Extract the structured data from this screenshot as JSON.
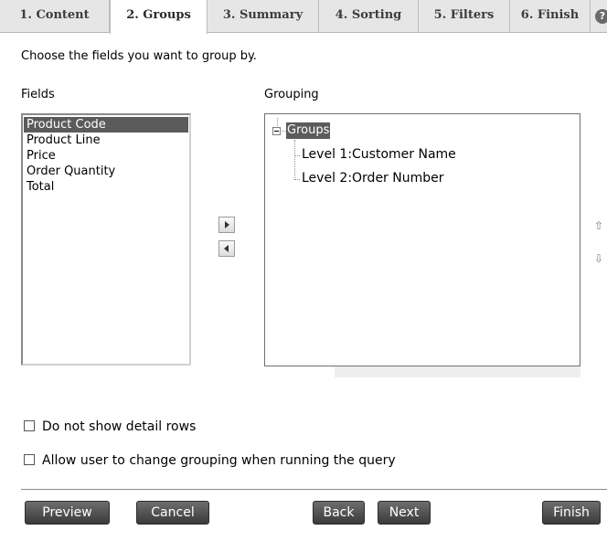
{
  "tabs": [
    {
      "label": "1. Content",
      "active": false
    },
    {
      "label": "2. Groups",
      "active": true
    },
    {
      "label": "3. Summary",
      "active": false
    },
    {
      "label": "4. Sorting",
      "active": false
    },
    {
      "label": "5. Filters",
      "active": false
    },
    {
      "label": "6. Finish",
      "active": false
    }
  ],
  "help_icon": "?",
  "instruction": "Choose the fields you want to group by.",
  "fields_label": "Fields",
  "grouping_label": "Grouping",
  "fields": [
    "Product Code",
    "Product Line",
    "Price",
    "Order Quantity",
    "Total"
  ],
  "selected_field": "Product Code",
  "tree": {
    "root": "Groups",
    "children": [
      "Level 1:Customer Name",
      "Level 2:Order Number"
    ]
  },
  "icons": {
    "move_right": "chevron-right-icon",
    "move_left": "chevron-left-icon",
    "move_up": "arrow-up-icon",
    "move_down": "arrow-down-icon"
  },
  "up_glyph": "⇧",
  "down_glyph": "⇩",
  "checkboxes": {
    "no_detail_rows": {
      "label": "Do not show detail rows",
      "checked": false
    },
    "allow_change_grouping": {
      "label": "Allow user to change grouping when running the query",
      "checked": false
    }
  },
  "buttons": {
    "preview": "Preview",
    "cancel": "Cancel",
    "back": "Back",
    "next": "Next",
    "finish": "Finish"
  },
  "colors": {
    "selection": "#5b5b5b",
    "tab_bar": "#e6e6e6",
    "button": "#4a4a4a"
  }
}
